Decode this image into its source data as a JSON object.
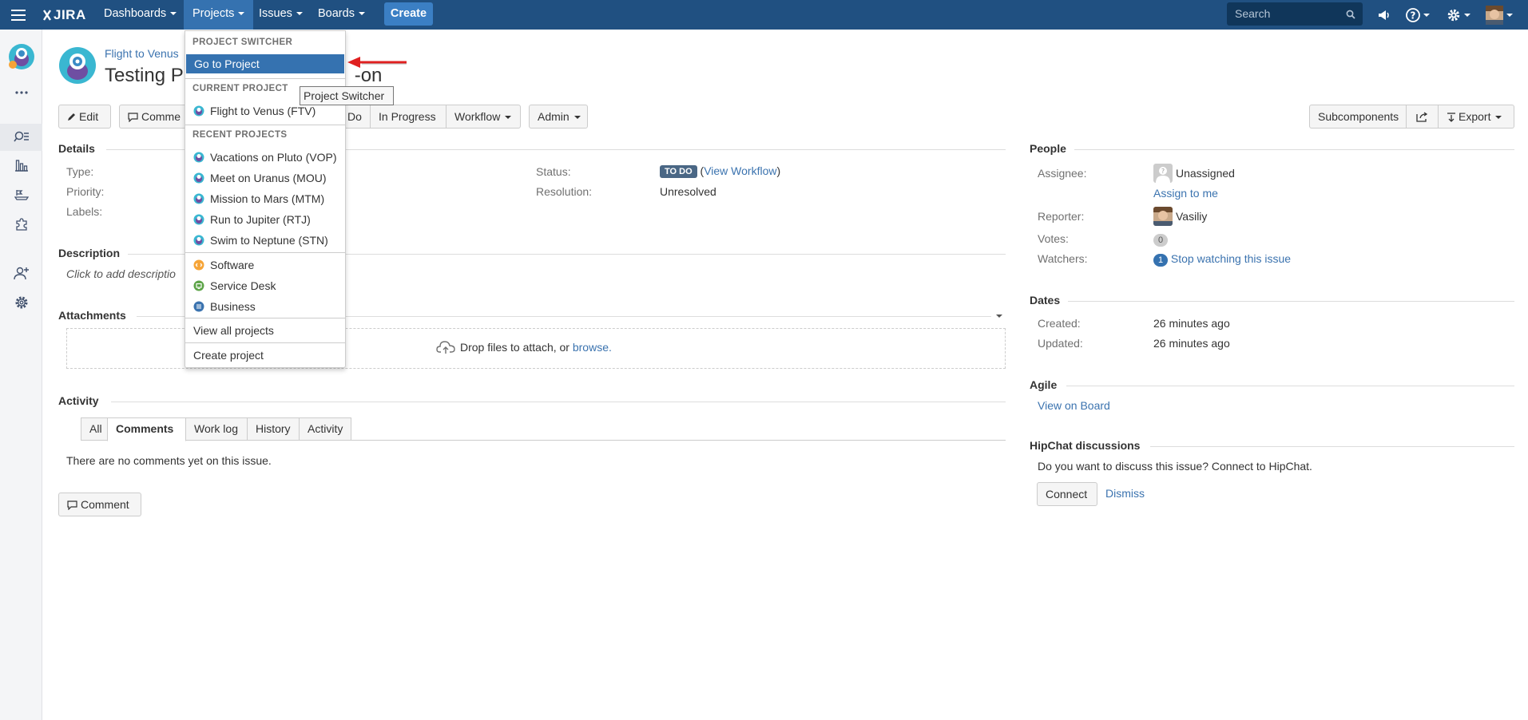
{
  "header": {
    "menu": [
      "Dashboards",
      "Projects",
      "Issues",
      "Boards"
    ],
    "create_label": "Create",
    "search_placeholder": "Search",
    "logo_text": "JIRA"
  },
  "breadcrumb": "Flight to Venus",
  "issue_title_start": "Testing P",
  "issue_title_end": "-on",
  "toolbar": {
    "edit": "Edit",
    "comment": "Comme",
    "todo_partial": "Do",
    "in_progress": "In Progress",
    "workflow": "Workflow",
    "admin": "Admin",
    "subcomponents": "Subcomponents",
    "export": "Export"
  },
  "details": {
    "heading": "Details",
    "type_label": "Type:",
    "priority_label": "Priority:",
    "labels_label": "Labels:",
    "status_label": "Status:",
    "status_value": "TO DO",
    "view_workflow": "View Workflow",
    "resolution_label": "Resolution:",
    "resolution_value": "Unresolved"
  },
  "description": {
    "heading": "Description",
    "placeholder": "Click to add descriptio"
  },
  "attachments": {
    "heading": "Attachments",
    "drop_text": "Drop files to attach, or",
    "browse": "browse."
  },
  "activity": {
    "heading": "Activity",
    "tabs": [
      "All",
      "Comments",
      "Work log",
      "History",
      "Activity"
    ],
    "active_tab": "Comments",
    "empty": "There are no comments yet on this issue.",
    "comment_button": "Comment"
  },
  "people": {
    "heading": "People",
    "assignee_label": "Assignee:",
    "assignee_value": "Unassigned",
    "assign_to_me": "Assign to me",
    "reporter_label": "Reporter:",
    "reporter_value": "Vasiliy",
    "votes_label": "Votes:",
    "votes_count": "0",
    "watchers_label": "Watchers:",
    "watchers_count": "1",
    "watch_link": "Stop watching this issue"
  },
  "dates": {
    "heading": "Dates",
    "created_label": "Created:",
    "created_value": "26 minutes ago",
    "updated_label": "Updated:",
    "updated_value": "26 minutes ago"
  },
  "agile": {
    "heading": "Agile",
    "link": "View on Board"
  },
  "hipchat": {
    "heading": "HipChat discussions",
    "text": "Do you want to discuss this issue? Connect to HipChat.",
    "connect": "Connect",
    "dismiss": "Dismiss"
  },
  "projects_menu": {
    "switcher_heading": "PROJECT SWITCHER",
    "go_to_project": "Go to Project",
    "current_heading": "CURRENT PROJECT",
    "current_project": "Flight to Venus (FTV)",
    "recent_heading": "RECENT PROJECTS",
    "recent": [
      "Vacations on Pluto (VOP)",
      "Meet on Uranus (MOU)",
      "Mission to Mars (MTM)",
      "Run to Jupiter (RTJ)",
      "Swim to Neptune (STN)"
    ],
    "types": [
      {
        "label": "Software",
        "color": "#f6a437"
      },
      {
        "label": "Service Desk",
        "color": "#5ba346"
      },
      {
        "label": "Business",
        "color": "#3b73af"
      }
    ],
    "view_all": "View all projects",
    "create_project": "Create project"
  },
  "tooltip": "Project Switcher",
  "colors": {
    "header_bg": "#205081",
    "link": "#3b73af",
    "highlight": "#3572b0",
    "status_lozenge": "#4a6785",
    "annotation_arrow": "#e02020"
  }
}
